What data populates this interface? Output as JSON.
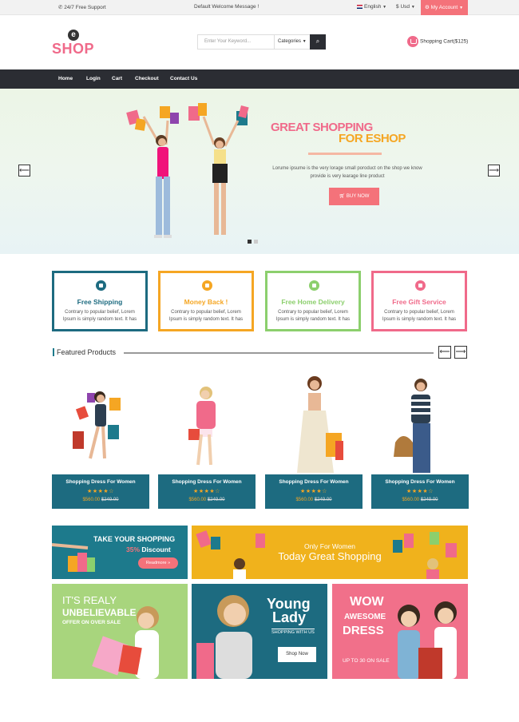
{
  "topbar": {
    "support": "24/7 Free Support",
    "welcome": "Default Welcome Message !",
    "language": "English",
    "currency": "Usd",
    "account": "My Account"
  },
  "header": {
    "logo_letter": "e",
    "logo_text": "SHOP",
    "search_placeholder": "Enter Your Keyword...",
    "category_label": "Categories",
    "cart_label": "Shopping Cart($125)"
  },
  "nav": [
    "Home",
    "Login",
    "Cart",
    "Checkout",
    "Contact Us"
  ],
  "hero": {
    "title_line1": "GREAT SHOPPING",
    "title_line2": "FOR ESHOP",
    "description": "Lorume ipsume is the very lorage small poroduct on the shop we know provide is very learage line product",
    "button": "BUY NOW"
  },
  "features": [
    {
      "title": "Free Shipping",
      "desc": "Contrary to popular belief, Lorem Ipsum is simply random text. It has",
      "color": "#1d6b80",
      "icon": "paper-plane-icon"
    },
    {
      "title": "Money Back !",
      "desc": "Contrary to popular belief, Lorem Ipsum is simply random text. It has",
      "color": "#f5a623",
      "icon": "money-icon"
    },
    {
      "title": "Free Home Delivery",
      "desc": "Contrary to popular belief, Lorem Ipsum is simply random text. It has",
      "color": "#8ccf6d",
      "icon": "truck-icon"
    },
    {
      "title": "Free Gift Service",
      "desc": "Contrary to popular belief, Lorem Ipsum is simply random text. It has",
      "color": "#f06a8a",
      "icon": "gift-icon"
    }
  ],
  "featured": {
    "title": "Featured Products",
    "products": [
      {
        "name": "Shopping Dress For Women",
        "stars": "★★★★☆",
        "price": "$560.00",
        "old_price": "$249.00"
      },
      {
        "name": "Shopping Dress For Women",
        "stars": "★★★★☆",
        "price": "$560.00",
        "old_price": "$249.00"
      },
      {
        "name": "Shopping Dress For Women",
        "stars": "★★★★☆",
        "price": "$560.00",
        "old_price": "$249.00"
      },
      {
        "name": "Shopping Dress For Women",
        "stars": "★★★★☆",
        "price": "$560.00",
        "old_price": "$249.00"
      }
    ]
  },
  "banners": {
    "b1": {
      "line1": "TAKE YOUR SHOPPING",
      "pct": "35%",
      "line2": "Discount",
      "button": "Readmore »"
    },
    "b2": {
      "line1": "Only For Women",
      "line2": "Today Great Shopping"
    },
    "b3": {
      "line1": "IT'S REALY",
      "line2": "UNBELIEVABLE",
      "line3": "OFFER ON OVER SALE"
    },
    "b4": {
      "line1": "Young",
      "line2": "Lady",
      "line3": "SHOPPING WITH US",
      "button": "Shop Now"
    },
    "b5": {
      "line1": "WOW",
      "line2": "AWESOME",
      "line3": "DRESS",
      "line4": "UP TO 30 ON SALE"
    }
  }
}
